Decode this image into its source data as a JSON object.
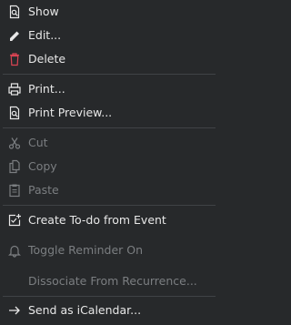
{
  "menu": {
    "items": [
      {
        "label": "Show",
        "icon": "show-icon",
        "enabled": true
      },
      {
        "label": "Edit...",
        "icon": "edit-pencil-icon",
        "enabled": true
      },
      {
        "label": "Delete",
        "icon": "delete-trash-icon",
        "enabled": true
      },
      {
        "label": "Print...",
        "icon": "printer-icon",
        "enabled": true
      },
      {
        "label": "Print Preview...",
        "icon": "print-preview-icon",
        "enabled": true
      },
      {
        "label": "Cut",
        "icon": "cut-scissors-icon",
        "enabled": false
      },
      {
        "label": "Copy",
        "icon": "copy-icon",
        "enabled": false
      },
      {
        "label": "Paste",
        "icon": "paste-clipboard-icon",
        "enabled": false
      },
      {
        "label": "Create To-do from Event",
        "icon": "create-todo-icon",
        "enabled": true
      },
      {
        "label": "Toggle Reminder On",
        "icon": "bell-icon",
        "enabled": false
      },
      {
        "label": "Dissociate From Recurrence...",
        "icon": "",
        "enabled": false
      },
      {
        "label": "Send as iCalendar...",
        "icon": "arrow-right-icon",
        "enabled": true
      }
    ]
  },
  "colors": {
    "background": "#27292b",
    "text": "#e8e8e8",
    "text_disabled": "#7b7e81",
    "separator": "#404346",
    "delete_icon": "#da4453"
  }
}
